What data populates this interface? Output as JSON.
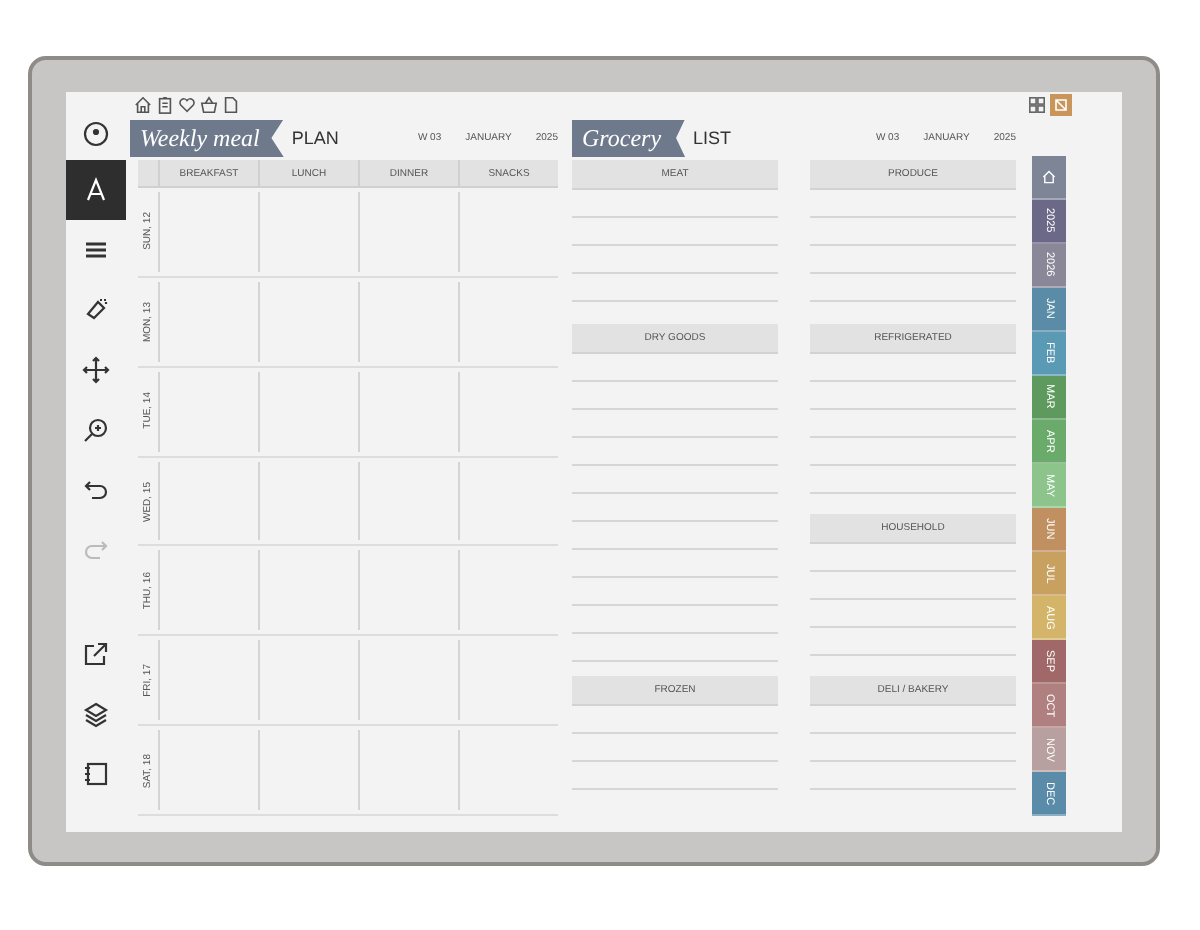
{
  "toolbar": [
    {
      "kind": "pen-menu",
      "selected": false
    },
    {
      "kind": "text",
      "selected": true
    },
    {
      "kind": "lines",
      "selected": false
    },
    {
      "kind": "eraser",
      "selected": false
    },
    {
      "kind": "move",
      "selected": false
    },
    {
      "kind": "zoom",
      "selected": false
    },
    {
      "kind": "undo",
      "selected": false
    },
    {
      "kind": "redo",
      "selected": false,
      "disabled": true
    },
    {
      "kind": "export",
      "selected": false
    },
    {
      "kind": "layers",
      "selected": false
    },
    {
      "kind": "notebook",
      "selected": false
    }
  ],
  "meal_plan": {
    "title_script": "Weekly meal",
    "title": "PLAN",
    "week": "W 03",
    "month": "JANUARY",
    "year": "2025",
    "columns": [
      "BREAKFAST",
      "LUNCH",
      "DINNER",
      "SNACKS"
    ],
    "days": [
      "SUN, 12",
      "MON, 13",
      "TUE, 14",
      "WED, 15",
      "THU, 16",
      "FRI, 17",
      "SAT, 18"
    ]
  },
  "grocery": {
    "title_script": "Grocery",
    "title": "LIST",
    "week": "W 03",
    "month": "JANUARY",
    "year": "2025",
    "sections": [
      {
        "label": "MEAT"
      },
      {
        "label": "PRODUCE"
      },
      {
        "label": "DRY GOODS"
      },
      {
        "label": "REFRIGERATED"
      },
      {
        "label": "HOUSEHOLD"
      },
      {
        "label": "FROZEN"
      },
      {
        "label": "DELI / BAKERY"
      }
    ]
  },
  "tabs": [
    {
      "kind": "home",
      "color": "#7d8596"
    },
    {
      "kind": "text",
      "label": "2025",
      "color": "#6b6888"
    },
    {
      "kind": "text",
      "label": "2026",
      "color": "#8a8898"
    },
    {
      "kind": "text",
      "label": "JAN",
      "color": "#5a8ca8"
    },
    {
      "kind": "text",
      "label": "FEB",
      "color": "#5b9ab5"
    },
    {
      "kind": "text",
      "label": "MAR",
      "color": "#5e9a5e"
    },
    {
      "kind": "text",
      "label": "APR",
      "color": "#6aaa6a"
    },
    {
      "kind": "text",
      "label": "MAY",
      "color": "#8cc48c"
    },
    {
      "kind": "text",
      "label": "JUN",
      "color": "#c09060"
    },
    {
      "kind": "text",
      "label": "JUL",
      "color": "#c8a060"
    },
    {
      "kind": "text",
      "label": "AUG",
      "color": "#d4b468"
    },
    {
      "kind": "text",
      "label": "SEP",
      "color": "#a06868"
    },
    {
      "kind": "text",
      "label": "OCT",
      "color": "#b08080"
    },
    {
      "kind": "text",
      "label": "NOV",
      "color": "#b8a0a0"
    },
    {
      "kind": "text",
      "label": "DEC",
      "color": "#5a8caa"
    }
  ]
}
